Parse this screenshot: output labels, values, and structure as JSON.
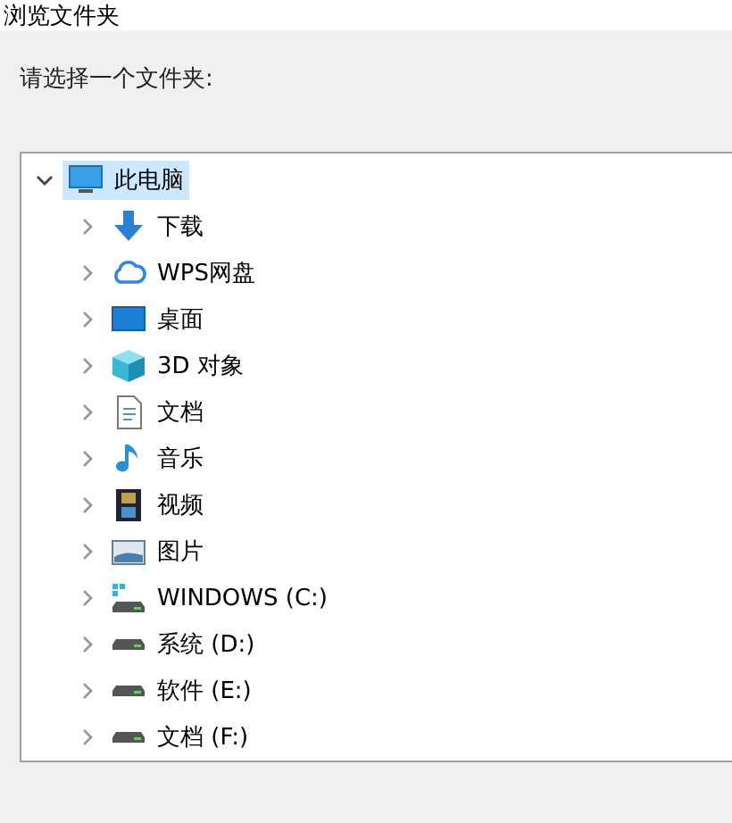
{
  "window": {
    "title": "浏览文件夹"
  },
  "prompt": "请选择一个文件夹:",
  "tree": [
    {
      "label": "此电脑",
      "kind": "computer",
      "expanded": true,
      "selected": true,
      "children": [
        {
          "label": "下载",
          "kind": "download",
          "expanded": false,
          "selected": false
        },
        {
          "label": "WPS网盘",
          "kind": "cloud",
          "expanded": false,
          "selected": false
        },
        {
          "label": "桌面",
          "kind": "desktop",
          "expanded": false,
          "selected": false
        },
        {
          "label": "3D 对象",
          "kind": "cube",
          "expanded": false,
          "selected": false
        },
        {
          "label": "文档",
          "kind": "document",
          "expanded": false,
          "selected": false
        },
        {
          "label": "音乐",
          "kind": "music",
          "expanded": false,
          "selected": false
        },
        {
          "label": "视频",
          "kind": "video",
          "expanded": false,
          "selected": false
        },
        {
          "label": "图片",
          "kind": "picture",
          "expanded": false,
          "selected": false
        },
        {
          "label": "WINDOWS (C:)",
          "kind": "system-drive",
          "expanded": false,
          "selected": false
        },
        {
          "label": "系统 (D:)",
          "kind": "drive",
          "expanded": false,
          "selected": false
        },
        {
          "label": "软件 (E:)",
          "kind": "drive",
          "expanded": false,
          "selected": false
        },
        {
          "label": "文档 (F:)",
          "kind": "drive",
          "expanded": false,
          "selected": false
        }
      ]
    }
  ]
}
